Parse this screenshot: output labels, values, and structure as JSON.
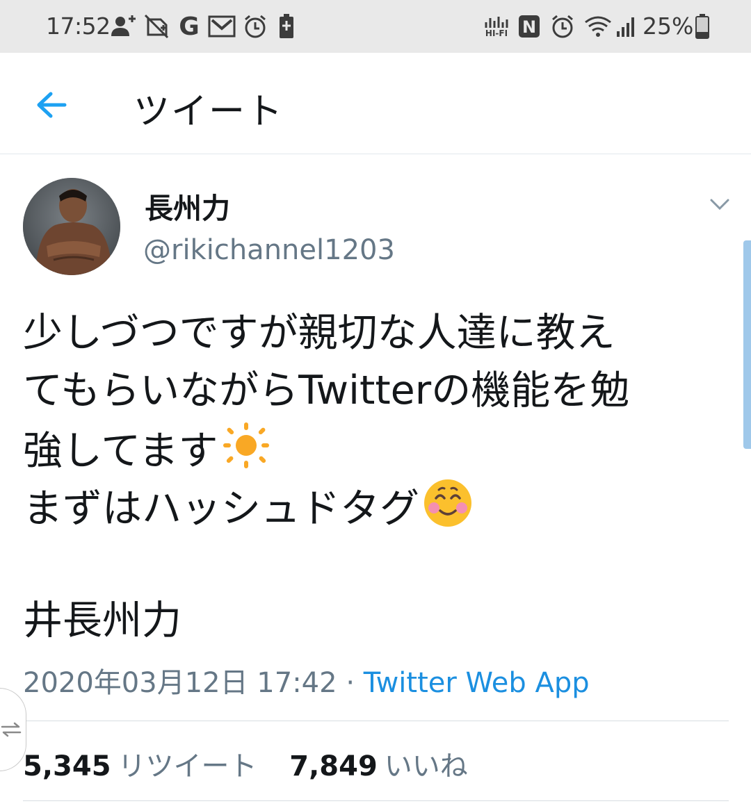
{
  "status_bar": {
    "time": "17:52",
    "battery_percent": "25%",
    "left_icons": [
      "add-person-icon",
      "no-sync-icon",
      "google-g-icon",
      "gmail-icon",
      "alarm-icon",
      "battery-alert-icon"
    ],
    "right_icons": [
      "hifi-icon",
      "nfc-icon",
      "alarm-clock-icon",
      "wifi-icon",
      "signal-icon",
      "battery-icon"
    ],
    "google_letter": "G",
    "hifi_text": "HI-FI",
    "nfc_letter": "N"
  },
  "header": {
    "title": "ツイート",
    "back_icon": "back-arrow-icon"
  },
  "tweet": {
    "author_name": "長州力",
    "author_handle": "@rikichannel1203",
    "text_lines": [
      "少しづつですが親切な人達に教え",
      "てもらいながらTwitterの機能を勉",
      "強してます",
      "まずはハッシュドタグ"
    ],
    "emojis": [
      "sun-emoji",
      "smiling-blush-emoji"
    ],
    "hashtag": "井長州力",
    "date": "2020年03月12日 17:42",
    "separator": "·",
    "source": "Twitter Web App",
    "stats": {
      "retweets_count": "5,345",
      "retweets_label": "リツイート",
      "likes_count": "7,849",
      "likes_label": "いいね"
    }
  },
  "colors": {
    "link_blue": "#1b8fe0",
    "secondary_text": "#657786",
    "status_bar_bg": "#e9e9e9",
    "scrollbar": "#9fc8ea"
  }
}
